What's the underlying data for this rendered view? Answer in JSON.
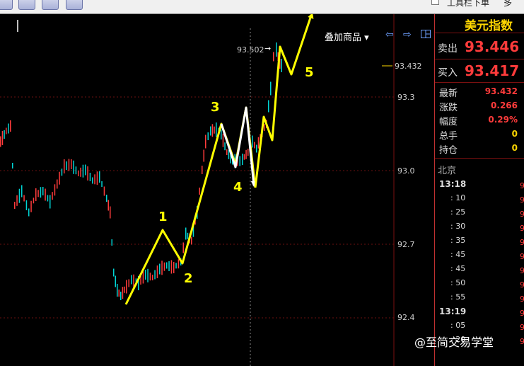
{
  "toolbar": {
    "tool_label": "工具栏下单",
    "more_label": "多"
  },
  "chart": {
    "overlay_button": "叠加商品 ▾",
    "nav_left": "⇦",
    "nav_right": "⇨",
    "price_axis": [
      "93.3",
      "93.0",
      "92.7",
      "92.4"
    ],
    "last_price_tag": "93.432",
    "peak_annotation": "93.502",
    "wave_labels": [
      "1",
      "2",
      "3",
      "4",
      "5"
    ]
  },
  "panel": {
    "title": "美元指数",
    "sell_label": "卖出",
    "sell_price": "93.446",
    "buy_label": "买入",
    "buy_price": "93.417",
    "stats": [
      {
        "label": "最新",
        "value": "93.432",
        "color": "#ff3b3b"
      },
      {
        "label": "涨跌",
        "value": "0.266",
        "color": "#ff3b3b"
      },
      {
        "label": "幅度",
        "value": "0.29%",
        "color": "#ff3b3b"
      },
      {
        "label": "总手",
        "value": "0",
        "color": "#ffd700"
      },
      {
        "label": "持仓",
        "value": "0",
        "color": "#ffd700"
      }
    ],
    "city": "北京",
    "ticks": [
      "13:18",
      ": 10",
      ": 25",
      ": 30",
      ": 35",
      ": 45",
      ": 45",
      ": 50",
      ": 55",
      "13:19",
      ": 05",
      ": 20"
    ]
  },
  "watermark": "@至简交易学堂",
  "colors": {
    "up": "#ff3b3b",
    "down": "#00d4d4",
    "annotation": "#ffff00"
  }
}
